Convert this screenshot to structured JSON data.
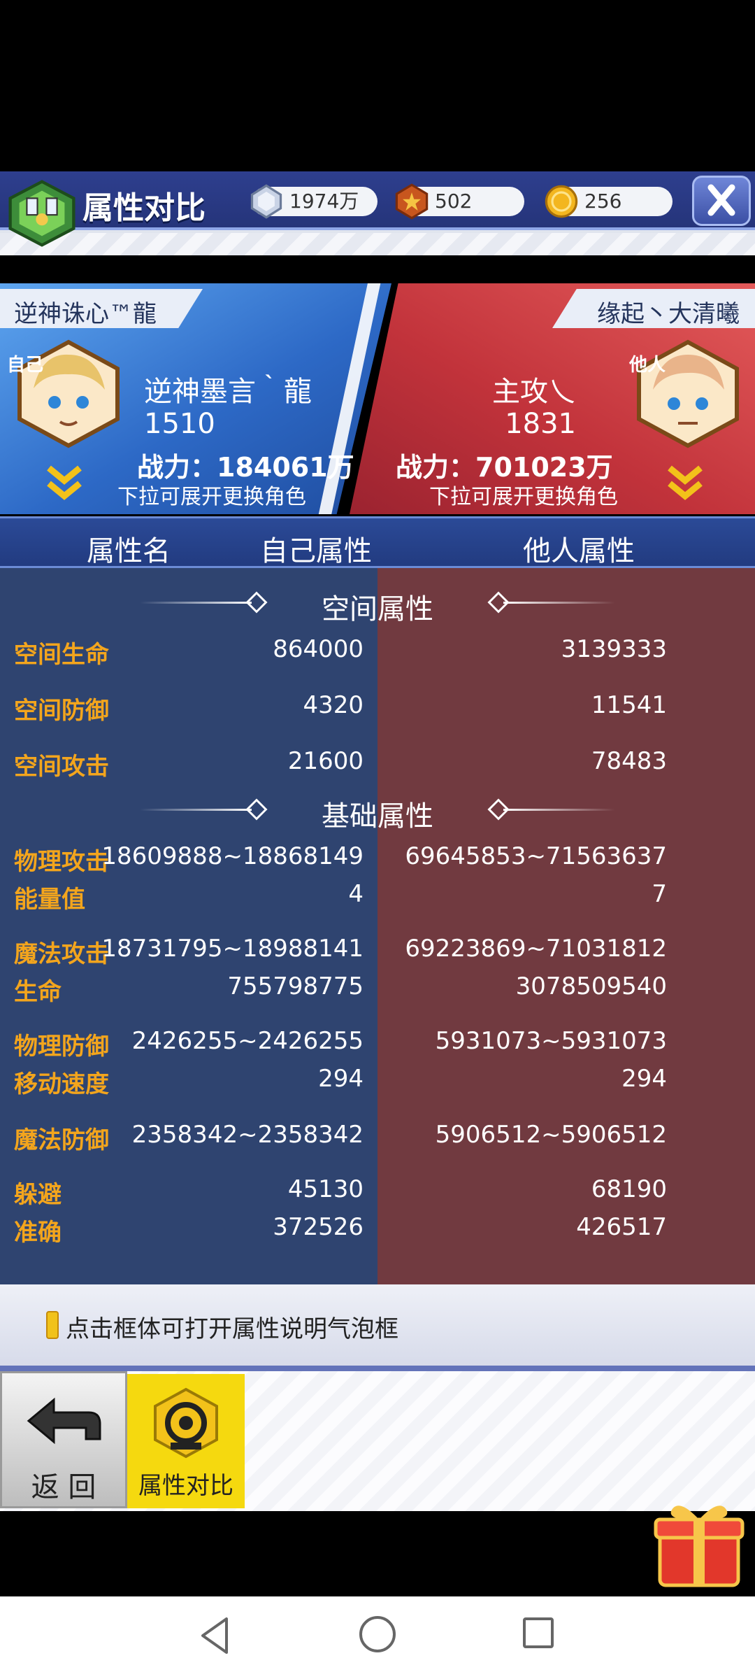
{
  "header": {
    "title": "属性对比",
    "currencies": [
      {
        "icon": "diamond-icon",
        "value": "1974万"
      },
      {
        "icon": "hexagon-medal-icon",
        "value": "502"
      },
      {
        "icon": "gold-coin-icon",
        "value": "256"
      }
    ],
    "close_icon": "close-icon"
  },
  "players": {
    "self": {
      "tab_name": "逆神诛心™龍",
      "badge": "自己",
      "name": "逆神墨言｀龍",
      "level": "1510",
      "power": "战力：184061万",
      "hint": "下拉可展开更换角色"
    },
    "other": {
      "tab_name": "缘起丶大清曦",
      "badge": "他人",
      "name": "主攻乀",
      "level": "1831",
      "power": "战力：701023万",
      "hint": "下拉可展开更换角色"
    }
  },
  "table": {
    "headers": [
      "属性名",
      "自己属性",
      "他人属性"
    ],
    "sections": [
      {
        "title": "空间属性",
        "rows": [
          {
            "label": "空间生命",
            "self": "864000",
            "other": "3139333"
          },
          {
            "label": "空间防御",
            "self": "4320",
            "other": "11541"
          },
          {
            "label": "空间攻击",
            "self": "21600",
            "other": "78483"
          }
        ]
      },
      {
        "title": "基础属性",
        "rows": [
          {
            "label": "物理攻击",
            "self": "18609888~18868149",
            "other": "69645853~71563637"
          },
          {
            "label": "能量值",
            "self": "4",
            "other": "7"
          },
          {
            "label": "魔法攻击",
            "self": "18731795~18988141",
            "other": "69223869~71031812"
          },
          {
            "label": "生命",
            "self": "755798775",
            "other": "3078509540"
          },
          {
            "label": "物理防御",
            "self": "2426255~2426255",
            "other": "5931073~5931073"
          },
          {
            "label": "移动速度",
            "self": "294",
            "other": "294"
          },
          {
            "label": "魔法防御",
            "self": "2358342~2358342",
            "other": "5906512~5906512"
          },
          {
            "label": "躲避",
            "self": "45130",
            "other": "68190"
          },
          {
            "label": "准确",
            "self": "372526",
            "other": "426517"
          }
        ]
      }
    ]
  },
  "info": {
    "text": "点击框体可打开属性说明气泡框"
  },
  "nav": {
    "back_label": "返 回",
    "tab_label": "属性对比"
  },
  "colors": {
    "self_panel": "#2f4470",
    "other_panel": "#713a40",
    "label_orange": "#f3a51d",
    "header_blue": "#2e3f8e"
  }
}
